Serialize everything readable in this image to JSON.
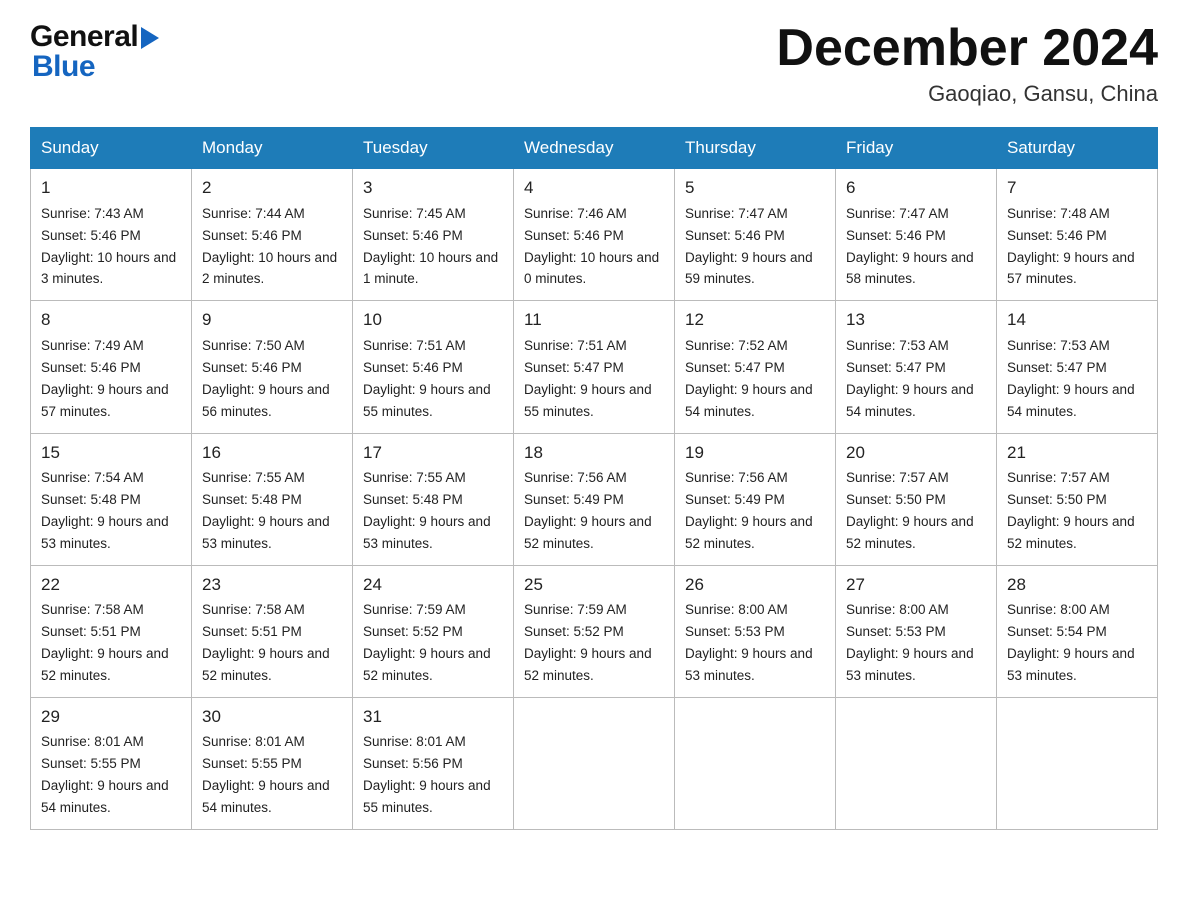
{
  "header": {
    "logo_general": "General",
    "logo_blue": "Blue",
    "month_title": "December 2024",
    "location": "Gaoqiao, Gansu, China"
  },
  "days_of_week": [
    "Sunday",
    "Monday",
    "Tuesday",
    "Wednesday",
    "Thursday",
    "Friday",
    "Saturday"
  ],
  "weeks": [
    [
      {
        "day": "1",
        "sunrise": "7:43 AM",
        "sunset": "5:46 PM",
        "daylight": "10 hours and 3 minutes."
      },
      {
        "day": "2",
        "sunrise": "7:44 AM",
        "sunset": "5:46 PM",
        "daylight": "10 hours and 2 minutes."
      },
      {
        "day": "3",
        "sunrise": "7:45 AM",
        "sunset": "5:46 PM",
        "daylight": "10 hours and 1 minute."
      },
      {
        "day": "4",
        "sunrise": "7:46 AM",
        "sunset": "5:46 PM",
        "daylight": "10 hours and 0 minutes."
      },
      {
        "day": "5",
        "sunrise": "7:47 AM",
        "sunset": "5:46 PM",
        "daylight": "9 hours and 59 minutes."
      },
      {
        "day": "6",
        "sunrise": "7:47 AM",
        "sunset": "5:46 PM",
        "daylight": "9 hours and 58 minutes."
      },
      {
        "day": "7",
        "sunrise": "7:48 AM",
        "sunset": "5:46 PM",
        "daylight": "9 hours and 57 minutes."
      }
    ],
    [
      {
        "day": "8",
        "sunrise": "7:49 AM",
        "sunset": "5:46 PM",
        "daylight": "9 hours and 57 minutes."
      },
      {
        "day": "9",
        "sunrise": "7:50 AM",
        "sunset": "5:46 PM",
        "daylight": "9 hours and 56 minutes."
      },
      {
        "day": "10",
        "sunrise": "7:51 AM",
        "sunset": "5:46 PM",
        "daylight": "9 hours and 55 minutes."
      },
      {
        "day": "11",
        "sunrise": "7:51 AM",
        "sunset": "5:47 PM",
        "daylight": "9 hours and 55 minutes."
      },
      {
        "day": "12",
        "sunrise": "7:52 AM",
        "sunset": "5:47 PM",
        "daylight": "9 hours and 54 minutes."
      },
      {
        "day": "13",
        "sunrise": "7:53 AM",
        "sunset": "5:47 PM",
        "daylight": "9 hours and 54 minutes."
      },
      {
        "day": "14",
        "sunrise": "7:53 AM",
        "sunset": "5:47 PM",
        "daylight": "9 hours and 54 minutes."
      }
    ],
    [
      {
        "day": "15",
        "sunrise": "7:54 AM",
        "sunset": "5:48 PM",
        "daylight": "9 hours and 53 minutes."
      },
      {
        "day": "16",
        "sunrise": "7:55 AM",
        "sunset": "5:48 PM",
        "daylight": "9 hours and 53 minutes."
      },
      {
        "day": "17",
        "sunrise": "7:55 AM",
        "sunset": "5:48 PM",
        "daylight": "9 hours and 53 minutes."
      },
      {
        "day": "18",
        "sunrise": "7:56 AM",
        "sunset": "5:49 PM",
        "daylight": "9 hours and 52 minutes."
      },
      {
        "day": "19",
        "sunrise": "7:56 AM",
        "sunset": "5:49 PM",
        "daylight": "9 hours and 52 minutes."
      },
      {
        "day": "20",
        "sunrise": "7:57 AM",
        "sunset": "5:50 PM",
        "daylight": "9 hours and 52 minutes."
      },
      {
        "day": "21",
        "sunrise": "7:57 AM",
        "sunset": "5:50 PM",
        "daylight": "9 hours and 52 minutes."
      }
    ],
    [
      {
        "day": "22",
        "sunrise": "7:58 AM",
        "sunset": "5:51 PM",
        "daylight": "9 hours and 52 minutes."
      },
      {
        "day": "23",
        "sunrise": "7:58 AM",
        "sunset": "5:51 PM",
        "daylight": "9 hours and 52 minutes."
      },
      {
        "day": "24",
        "sunrise": "7:59 AM",
        "sunset": "5:52 PM",
        "daylight": "9 hours and 52 minutes."
      },
      {
        "day": "25",
        "sunrise": "7:59 AM",
        "sunset": "5:52 PM",
        "daylight": "9 hours and 52 minutes."
      },
      {
        "day": "26",
        "sunrise": "8:00 AM",
        "sunset": "5:53 PM",
        "daylight": "9 hours and 53 minutes."
      },
      {
        "day": "27",
        "sunrise": "8:00 AM",
        "sunset": "5:53 PM",
        "daylight": "9 hours and 53 minutes."
      },
      {
        "day": "28",
        "sunrise": "8:00 AM",
        "sunset": "5:54 PM",
        "daylight": "9 hours and 53 minutes."
      }
    ],
    [
      {
        "day": "29",
        "sunrise": "8:01 AM",
        "sunset": "5:55 PM",
        "daylight": "9 hours and 54 minutes."
      },
      {
        "day": "30",
        "sunrise": "8:01 AM",
        "sunset": "5:55 PM",
        "daylight": "9 hours and 54 minutes."
      },
      {
        "day": "31",
        "sunrise": "8:01 AM",
        "sunset": "5:56 PM",
        "daylight": "9 hours and 55 minutes."
      },
      null,
      null,
      null,
      null
    ]
  ]
}
